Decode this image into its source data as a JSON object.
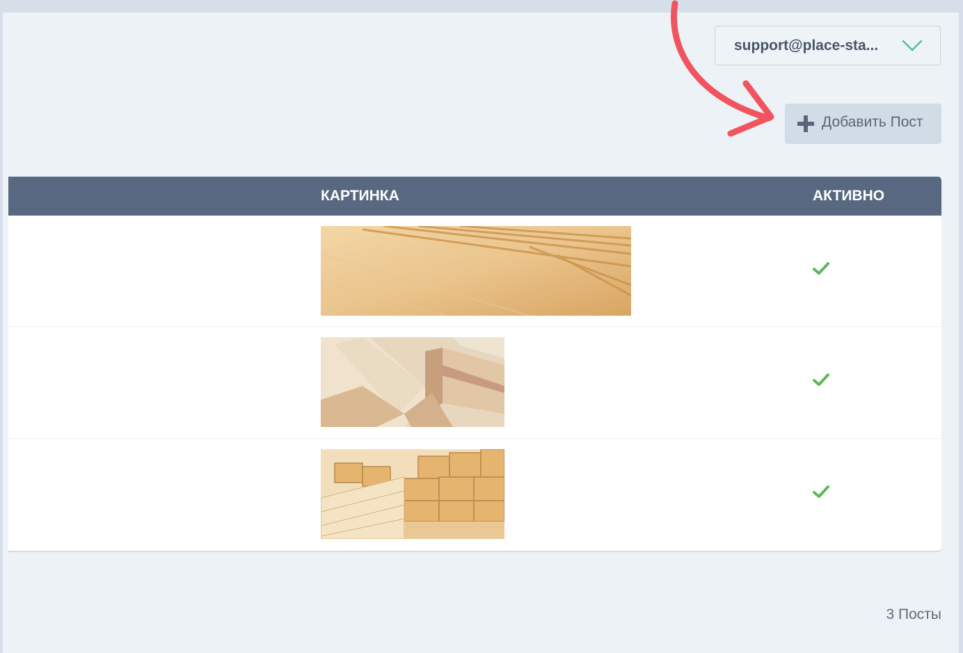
{
  "header": {
    "account_select": {
      "value": "support@place-sta..."
    },
    "add_post_label": "Добавить Пост"
  },
  "table": {
    "columns": {
      "image": "КАРТИНКА",
      "active": "АКТИВНО"
    },
    "rows": [
      {
        "image": "wood-planks-photo",
        "active": true
      },
      {
        "image": "wood-beams-photo",
        "active": true
      },
      {
        "image": "lumber-stack-photo",
        "active": true
      }
    ]
  },
  "footer": {
    "count_label": "3 Посты"
  },
  "colors": {
    "table_header": "#586881",
    "check": "#5cb85c",
    "annotation_arrow": "#f0555f",
    "page_background": "#edf2f7"
  }
}
